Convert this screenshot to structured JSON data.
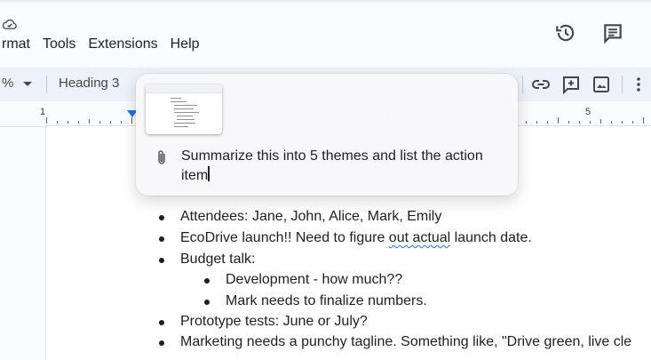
{
  "menu": {
    "items": [
      "rmat",
      "Tools",
      "Extensions",
      "Help"
    ]
  },
  "icons": {
    "cloud": "cloud-saved-icon",
    "history": "version-history-icon",
    "comments": "comments-icon",
    "zoom_caret": "chevron-down-icon",
    "link": "insert-link-icon",
    "comment_add": "add-comment-icon",
    "image": "insert-image-icon",
    "more": "more-vert-icon",
    "attachment": "paperclip-icon"
  },
  "toolbar": {
    "zoom_value": "%",
    "paragraph_style": "Heading 3"
  },
  "ruler": {
    "num_left": "1",
    "num_right": "5"
  },
  "popup": {
    "prompt_text": "Summarize this into 5 themes and list the action item"
  },
  "doc": {
    "attendees": "Attendees: Jane, John, Alice, Mark, Emily",
    "ecodrive_before": "EcoDrive launch!! Need to figure ",
    "ecodrive_error": "out actual",
    "ecodrive_after": " launch date.",
    "budget": "Budget talk:",
    "development": "Development - how much??",
    "mark_numbers": "Mark needs to finalize numbers.",
    "prototype": "Prototype tests: June or July?",
    "marketing": "Marketing needs a punchy tagline. Something like, \"Drive green, live cle"
  },
  "colors": {
    "accent": "#1a73e8",
    "toolbar_bg": "#edf2fa",
    "page_bg": "#ffffff"
  }
}
